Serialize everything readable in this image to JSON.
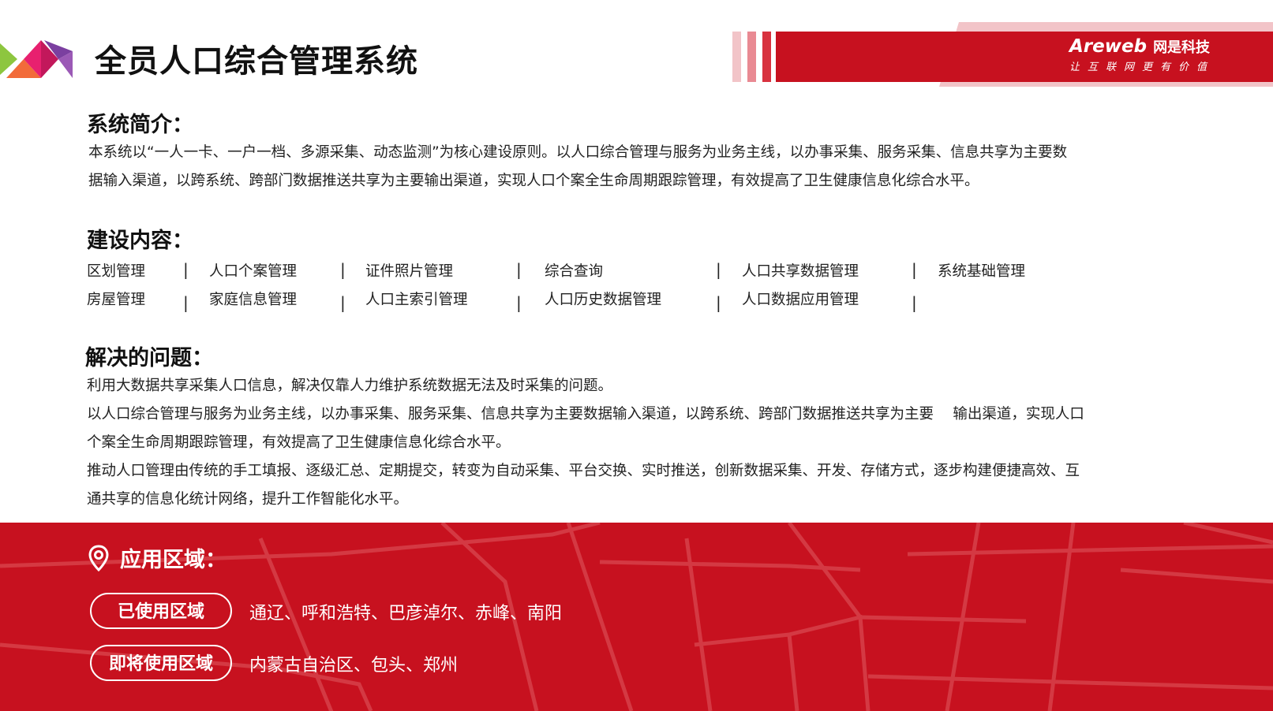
{
  "title": "全员人口综合管理系统",
  "brand": {
    "name": "Areweb",
    "name_cn": "网是科技",
    "slogan": "让互联网更有价值"
  },
  "intro": {
    "heading": "系统简介：",
    "lines": [
      "本系统以“一人一卡、一户一档、多源采集、动态监测”为核心建设原则。以人口综合管理与服务为业务主线，以办事采集、服务采集、信息共享为主要数",
      "据输入渠道，以跨系统、跨部门数据推送共享为主要输出渠道，实现人口个案全生命周期跟踪管理，有效提高了卫生健康信息化综合水平。"
    ]
  },
  "construction": {
    "heading": "建设内容：",
    "row1": [
      "区划管理",
      "人口个案管理",
      "证件照片管理",
      "综合查询",
      "人口共享数据管理",
      "系统基础管理"
    ],
    "row2": [
      "房屋管理",
      "家庭信息管理",
      "人口主索引管理",
      "人口历史数据管理",
      "人口数据应用管理"
    ],
    "separator": "|"
  },
  "problems": {
    "heading": "解决的问题：",
    "lines": [
      "利用大数据共享采集人口信息，解决仅靠人力维护系统数据无法及时采集的问题。",
      "以人口综合管理与服务为业务主线，以办事采集、服务采集、信息共享为主要数据输入渠道，以跨系统、跨部门数据推送共享为主要　 输出渠道，实现人口",
      "个案全生命周期跟踪管理，有效提高了卫生健康信息化综合水平。",
      "推动人口管理由传统的手工填报、逐级汇总、定期提交，转变为自动采集、平台交换、实时推送，创新数据采集、开发、存储方式，逐步构建便捷高效、互",
      "通共享的信息化统计网络，提升工作智能化水平。"
    ]
  },
  "regions": {
    "heading": "应用区域：",
    "used_label": "已使用区域",
    "used_value": "通辽、呼和浩特、巴彦淖尔、赤峰、南阳",
    "upcoming_label": "即将使用区域",
    "upcoming_value": "内蒙古自治区、包头、郑州"
  },
  "colors": {
    "brand_red": "#c7111f",
    "pink": "#f2c4c8"
  }
}
